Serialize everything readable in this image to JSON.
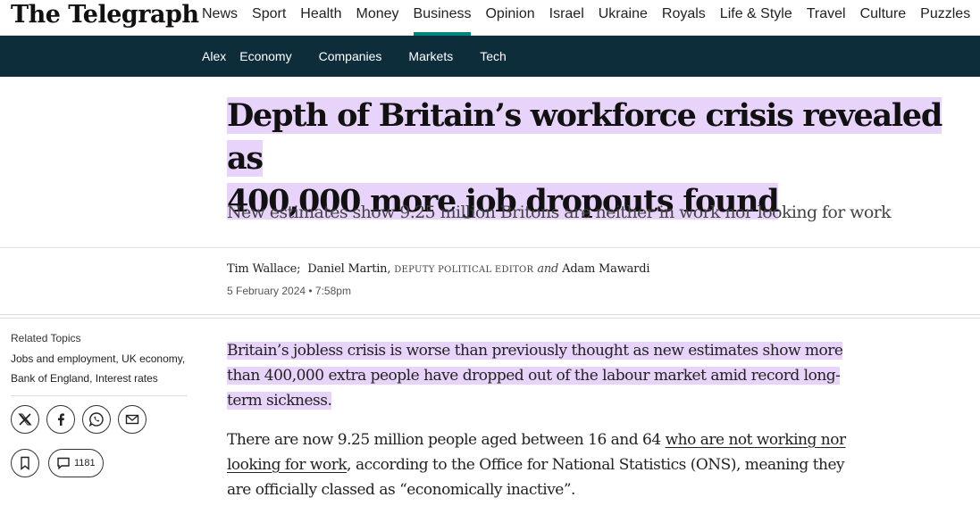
{
  "brand": {
    "logo": "The Telegraph"
  },
  "main_nav": [
    "News",
    "Sport",
    "Health",
    "Money",
    "Business",
    "Opinion",
    "Israel",
    "Ukraine",
    "Royals",
    "Life & Style",
    "Travel",
    "Culture",
    "Puzzles"
  ],
  "main_nav_active": "Business",
  "sub_nav": [
    "Alex",
    "Economy",
    "Companies",
    "Markets",
    "Tech"
  ],
  "article": {
    "headline_line1": "Depth of Britain’s workforce crisis revealed as",
    "headline_line2": "400,000 more job dropouts found",
    "standfirst": "New estimates show 9.25 million Britons are neither in work nor looking for work",
    "byline": {
      "author1": "Tim Wallace;",
      "author2": "Daniel Martin,",
      "author2_role": "DEPUTY POLITICAL EDITOR",
      "conjunction": "and",
      "author3": "Adam Mawardi"
    },
    "date": "5 February 2024 • 7:58pm",
    "para1": "Britain’s jobless crisis is worse than previously thought as new estimates show more than 400,000 extra people have dropped out of the labour market amid record long-term sickness.",
    "para2_before": "There are now 9.25 million people aged between 16 and 64 ",
    "para2_link": "who are not working nor looking for work",
    "para2_after": ", according to the Office for National Statistics (ONS), meaning they are officially classed as “economically inactive”."
  },
  "sidebar": {
    "related_title": "Related Topics",
    "topics": [
      "Jobs and employment,",
      "UK economy,",
      "Bank of England,",
      "Interest rates"
    ],
    "share_icons": [
      "x-icon",
      "facebook-icon",
      "whatsapp-icon",
      "email-icon"
    ],
    "comment_count": "1181"
  },
  "colors": {
    "nav_dark": "#0e2d3b",
    "highlight": "#e8d3fb",
    "active_underline": "#00847f"
  }
}
